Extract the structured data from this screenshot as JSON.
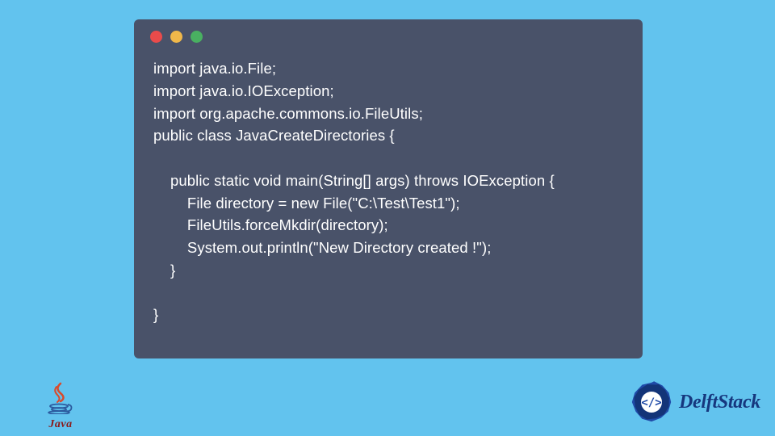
{
  "code": {
    "lines": [
      "import java.io.File;",
      "import java.io.IOException;",
      "import org.apache.commons.io.FileUtils;",
      "public class JavaCreateDirectories {",
      "",
      "    public static void main(String[] args) throws IOException {",
      "        File directory = new File(\"C:\\Test\\Test1\");",
      "        FileUtils.forceMkdir(directory);",
      "        System.out.println(\"New Directory created !\");",
      "    }",
      "",
      "}"
    ]
  },
  "window": {
    "dot_colors": {
      "red": "#e94b4b",
      "yellow": "#f0b84a",
      "green": "#49b061"
    }
  },
  "logos": {
    "java_label": "Java",
    "delft_label": "DelftStack"
  },
  "colors": {
    "page_bg": "#62c3ee",
    "window_bg": "#495269",
    "code_text": "#ffffff",
    "delft_blue": "#16377e"
  }
}
